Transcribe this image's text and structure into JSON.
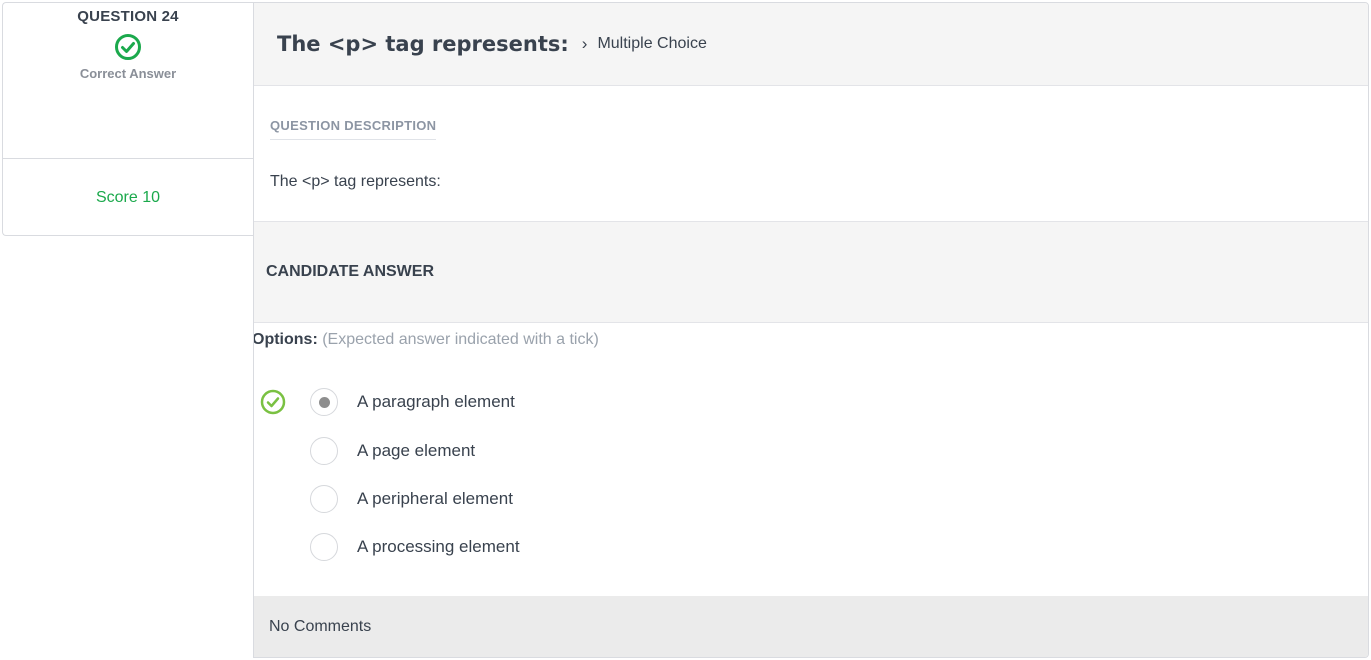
{
  "summary": {
    "question_number": "QUESTION 24",
    "status_icon": "check-circle-icon",
    "status_text": "Correct Answer",
    "score_text": "Score 10"
  },
  "header": {
    "title": "The <p> tag represents:",
    "separator": "›",
    "type": "Multiple Choice"
  },
  "description": {
    "label": "QUESTION DESCRIPTION",
    "text": "The <p> tag represents:"
  },
  "candidate": {
    "heading": "CANDIDATE ANSWER",
    "options_label": "Options:",
    "options_hint": "(Expected answer indicated with a tick)",
    "options": [
      {
        "label": "A paragraph element",
        "selected": true,
        "expected": true
      },
      {
        "label": "A page element",
        "selected": false,
        "expected": false
      },
      {
        "label": "A peripheral element",
        "selected": false,
        "expected": false
      },
      {
        "label": "A processing element",
        "selected": false,
        "expected": false
      }
    ]
  },
  "comments": {
    "text": "No Comments"
  },
  "colors": {
    "success": "#1ba94c",
    "tick": "#7ac142",
    "text": "#39424e",
    "muted": "#8c95a3"
  }
}
